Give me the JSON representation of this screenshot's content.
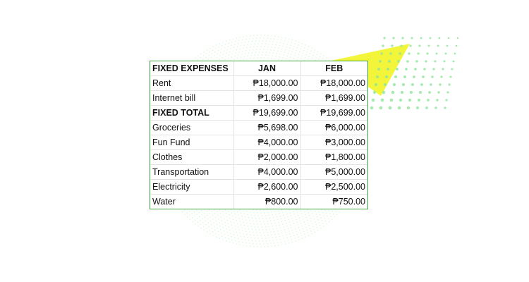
{
  "table": {
    "headers": [
      "FIXED EXPENSES",
      "JAN",
      "FEB"
    ],
    "rows": [
      {
        "label": "Rent",
        "jan": "₱18,000.00",
        "feb": "₱18,000.00",
        "bold": false
      },
      {
        "label": "Internet bill",
        "jan": "₱1,699.00",
        "feb": "₱1,699.00",
        "bold": false
      },
      {
        "label": "FIXED TOTAL",
        "jan": "₱19,699.00",
        "feb": "₱19,699.00",
        "bold": true
      },
      {
        "label": "Groceries",
        "jan": "₱5,698.00",
        "feb": "₱6,000.00",
        "bold": false
      },
      {
        "label": "Fun Fund",
        "jan": "₱4,000.00",
        "feb": "₱3,000.00",
        "bold": false
      },
      {
        "label": "Clothes",
        "jan": "₱2,000.00",
        "feb": "₱1,800.00",
        "bold": false
      },
      {
        "label": "Transportation",
        "jan": "₱4,000.00",
        "feb": "₱5,000.00",
        "bold": false
      },
      {
        "label": "Electricity",
        "jan": "₱2,600.00",
        "feb": "₱2,500.00",
        "bold": false
      },
      {
        "label": "Water",
        "jan": "₱800.00",
        "feb": "₱750.00",
        "bold": false
      }
    ]
  },
  "colors": {
    "border_accent": "#3aa63a",
    "decor_yellow": "#f2f53a",
    "decor_dots": "#8fe59a"
  }
}
